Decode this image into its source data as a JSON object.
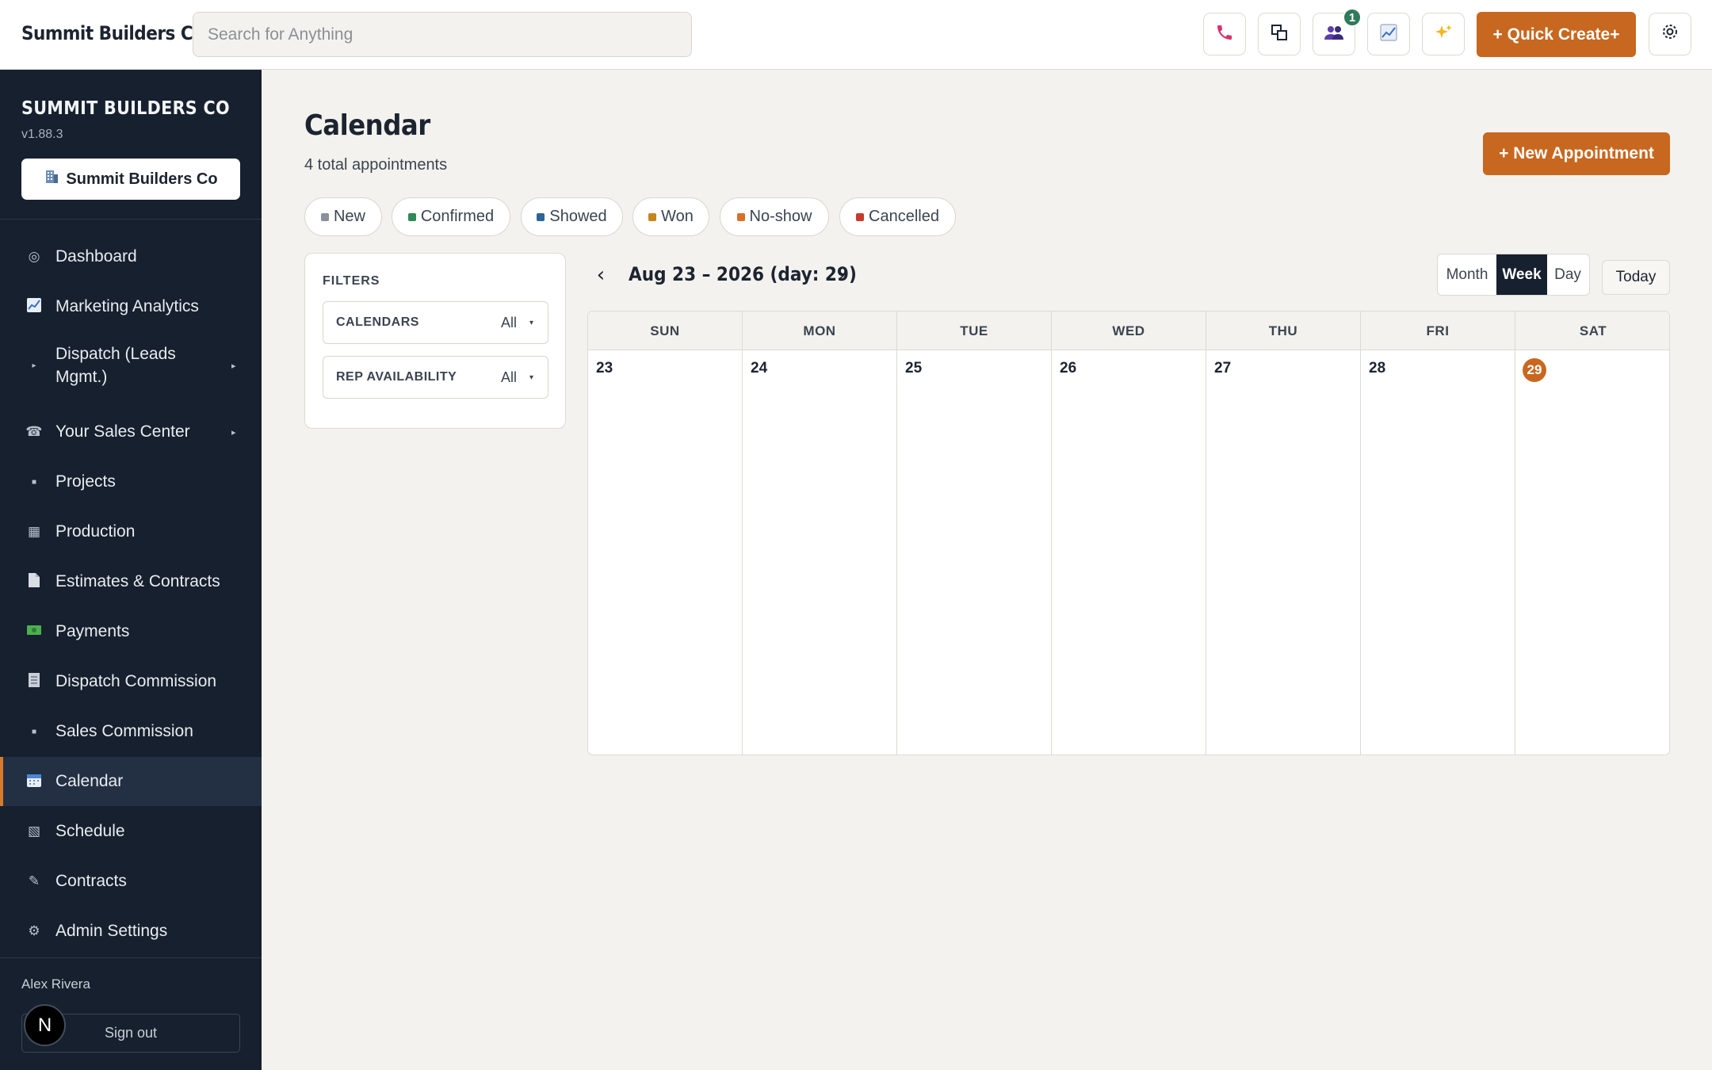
{
  "topbar": {
    "brand": "Summit Builders Co",
    "search_placeholder": "Search for Anything",
    "notification_count": "1",
    "quick_create_label": "+ Quick Create+",
    "icons": [
      "phone-icon",
      "windows-icon",
      "team-icon",
      "chart-icon",
      "sparkles-icon",
      "gear-icon"
    ]
  },
  "sidebar": {
    "title": "SUMMIT BUILDERS CO",
    "version": "v1.88.3",
    "company_button": "Summit Builders Co",
    "items": [
      {
        "label": "Dashboard",
        "icon": "target-icon"
      },
      {
        "label": "Marketing Analytics",
        "icon": "chart-icon"
      },
      {
        "label": "Dispatch (Leads Mgmt.)",
        "icon": "bullet-icon",
        "expandable": true
      },
      {
        "label": "Your Sales Center",
        "icon": "telephone-icon",
        "expandable": true
      },
      {
        "label": "Projects",
        "icon": "square-icon"
      },
      {
        "label": "Production",
        "icon": "grid-icon"
      },
      {
        "label": "Estimates & Contracts",
        "icon": "document-icon"
      },
      {
        "label": "Payments",
        "icon": "money-icon"
      },
      {
        "label": "Dispatch Commission",
        "icon": "ledger-icon"
      },
      {
        "label": "Sales Commission",
        "icon": "square-icon"
      },
      {
        "label": "Calendar",
        "icon": "calendar-icon",
        "active": true
      },
      {
        "label": "Schedule",
        "icon": "schedule-icon"
      },
      {
        "label": "Contracts",
        "icon": "pen-icon"
      },
      {
        "label": "Admin Settings",
        "icon": "gear-icon"
      }
    ],
    "user_name": "Alex Rivera",
    "sign_out": "Sign out",
    "avatar_letter": "N"
  },
  "main": {
    "title": "Calendar",
    "subtitle": "4 total appointments",
    "new_appointment": "+ New Appointment",
    "status_pills": [
      {
        "label": "New",
        "color": "#8a9099"
      },
      {
        "label": "Confirmed",
        "color": "#2f8a57"
      },
      {
        "label": "Showed",
        "color": "#2e6496"
      },
      {
        "label": "Won",
        "color": "#c8841f"
      },
      {
        "label": "No-show",
        "color": "#d8702a"
      },
      {
        "label": "Cancelled",
        "color": "#c83a2e"
      }
    ],
    "filters": {
      "title": "FILTERS",
      "calendars_label": "CALENDARS",
      "calendars_value": "All",
      "rep_label": "REP AVAILABILITY",
      "rep_value": "All"
    },
    "range_label": "Aug 23 – 2026 (day: 29)",
    "views": [
      "Month",
      "Week",
      "Day"
    ],
    "active_view": "Week",
    "today_label": "Today",
    "weekdays": [
      "SUN",
      "MON",
      "TUE",
      "WED",
      "THU",
      "FRI",
      "SAT"
    ],
    "days": [
      "23",
      "24",
      "25",
      "26",
      "27",
      "28",
      "29"
    ],
    "today_day": "29"
  },
  "colors": {
    "accent": "#c8671f",
    "sidebar_bg": "#16202e",
    "page_bg": "#f3f2ee"
  }
}
